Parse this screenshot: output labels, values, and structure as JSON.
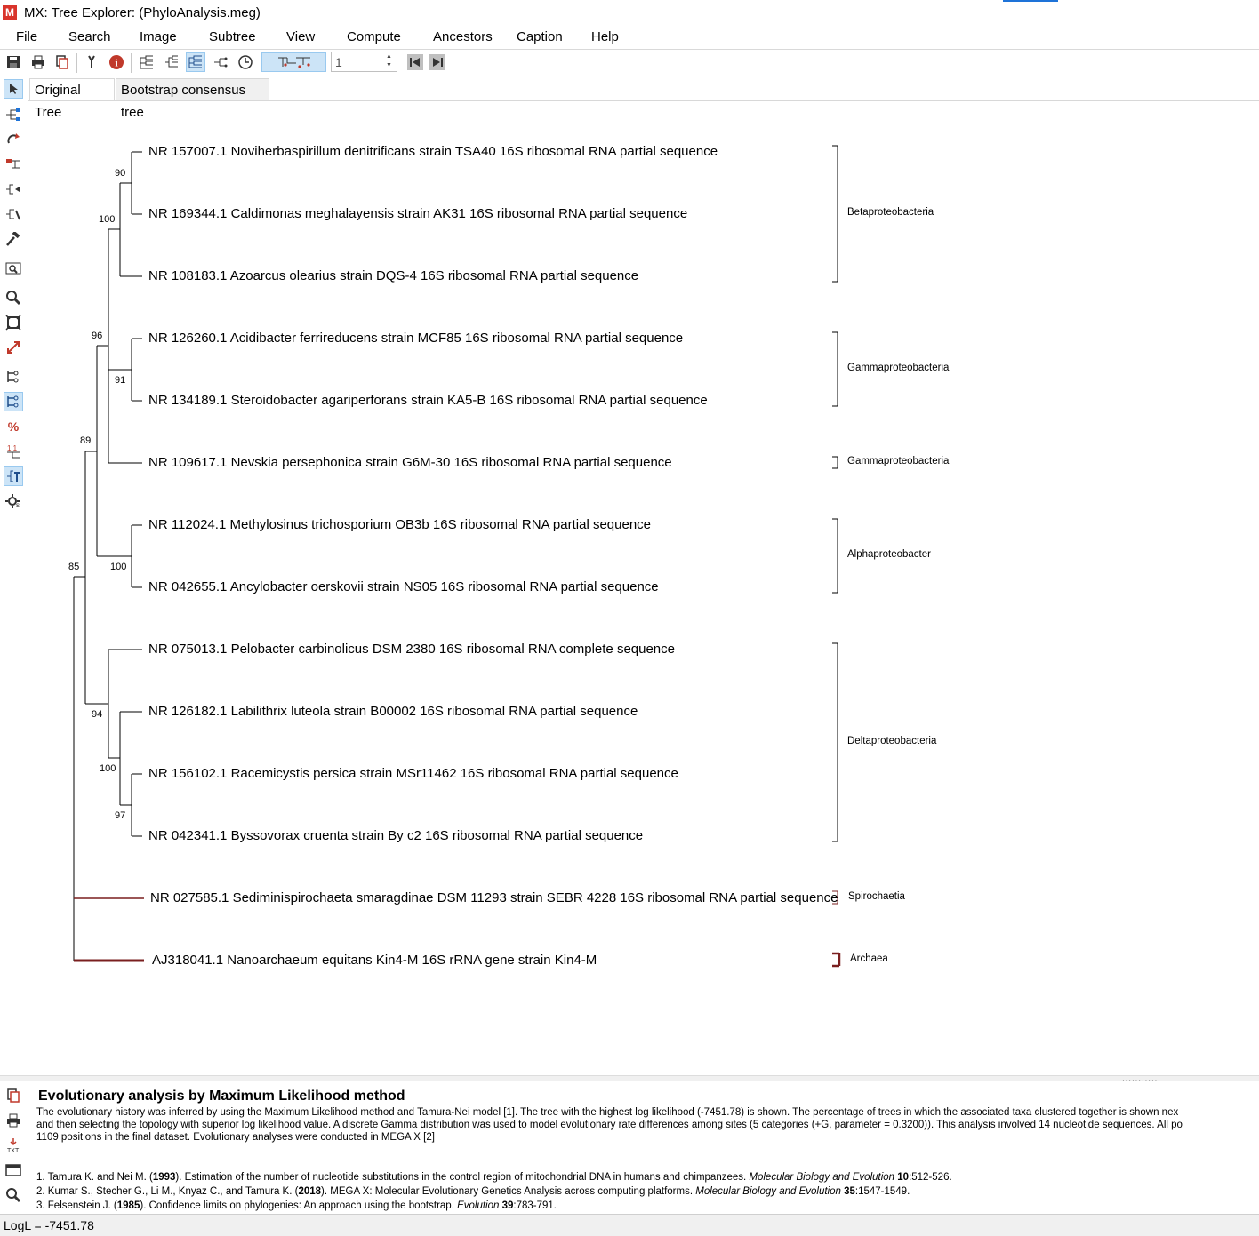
{
  "window": {
    "title": "MX: Tree Explorer: (PhyloAnalysis.meg)"
  },
  "menu": [
    "File",
    "Search",
    "Image",
    "Subtree",
    "View",
    "Compute",
    "Ancestors",
    "Caption",
    "Help"
  ],
  "toolbar": {
    "spin_value": "1"
  },
  "tabs": {
    "original": "Original Tree",
    "consensus": "Bootstrap consensus tree"
  },
  "tree": {
    "leaves": [
      "NR 157007.1 Noviherbaspirillum denitrificans strain TSA40 16S ribosomal RNA partial sequence",
      "NR 169344.1 Caldimonas meghalayensis strain AK31 16S ribosomal RNA partial sequence",
      "NR 108183.1 Azoarcus olearius strain DQS-4 16S ribosomal RNA partial sequence",
      "NR 126260.1 Acidibacter ferrireducens strain MCF85 16S ribosomal RNA partial sequence",
      "NR 134189.1 Steroidobacter agariperforans strain KA5-B 16S ribosomal RNA partial sequence",
      "NR 109617.1 Nevskia persephonica strain G6M-30 16S ribosomal RNA partial sequence",
      "NR 112024.1 Methylosinus trichosporium OB3b 16S ribosomal RNA partial sequence",
      "NR 042655.1 Ancylobacter oerskovii strain NS05 16S ribosomal RNA partial sequence",
      "NR 075013.1 Pelobacter carbinolicus DSM 2380 16S ribosomal RNA complete sequence",
      "NR 126182.1 Labilithrix luteola strain B00002 16S ribosomal RNA partial sequence",
      "NR 156102.1 Racemicystis persica strain MSr11462 16S ribosomal RNA partial sequence",
      "NR 042341.1 Byssovorax cruenta strain By c2 16S ribosomal RNA partial sequence",
      "NR 027585.1 Sediminispirochaeta smaragdinae DSM 11293 strain SEBR 4228 16S ribosomal RNA partial sequence",
      "AJ318041.1 Nanoarchaeum equitans Kin4-M 16S rRNA gene strain Kin4-M"
    ],
    "bootstrap": [
      "90",
      "100",
      "96",
      "91",
      "89",
      "100",
      "85",
      "94",
      "100",
      "97"
    ],
    "groups": [
      "Betaproteobacteria",
      "Gammaproteobacteria",
      "Gammaproteobacteria",
      "Alphaproteobacter",
      "Deltaproteobacteria",
      "Spirochaetia",
      "Archaea"
    ],
    "colors": {
      "branch": "#000000",
      "outgroup_branch": "#7a1f1f"
    }
  },
  "caption": {
    "title": "Evolutionary analysis by Maximum Likelihood method",
    "line1": "The evolutionary history was inferred by using the Maximum Likelihood method and Tamura-Nei model [1]. The tree with the highest log likelihood (-7451.78) is shown. The percentage of trees in which the associated taxa clustered together is shown nex",
    "line2": "and then selecting the topology with superior log likelihood value. A discrete Gamma distribution was used to model evolutionary rate differences among sites (5 categories (+G, parameter = 0.3200)). This analysis involved 14 nucleotide sequences. All po",
    "line3": "1109 positions in the final dataset. Evolutionary analyses were conducted in MEGA X [2]",
    "refs": [
      {
        "pre": "1. Tamura K. and Nei M. (",
        "year": "1993",
        "mid": "). Estimation of the number of nucleotide substitutions in the control region of mitochondrial DNA in humans and chimpanzees. ",
        "journal": "Molecular Biology and Evolution",
        "vol": " 10",
        "pages": ":512-526."
      },
      {
        "pre": "2. Kumar S., Stecher G., Li M., Knyaz C., and Tamura K. (",
        "year": "2018",
        "mid": "). MEGA X: Molecular Evolutionary Genetics Analysis across computing platforms. ",
        "journal": "Molecular Biology and Evolution",
        "vol": " 35",
        "pages": ":1547-1549."
      },
      {
        "pre": "3. Felsenstein J. (",
        "year": "1985",
        "mid": "). Confidence limits on phylogenies: An approach using the bootstrap. ",
        "journal": "Evolution",
        "vol": " 39",
        "pages": ":783-791."
      }
    ]
  },
  "status": {
    "logl": "LogL = -7451.78"
  }
}
